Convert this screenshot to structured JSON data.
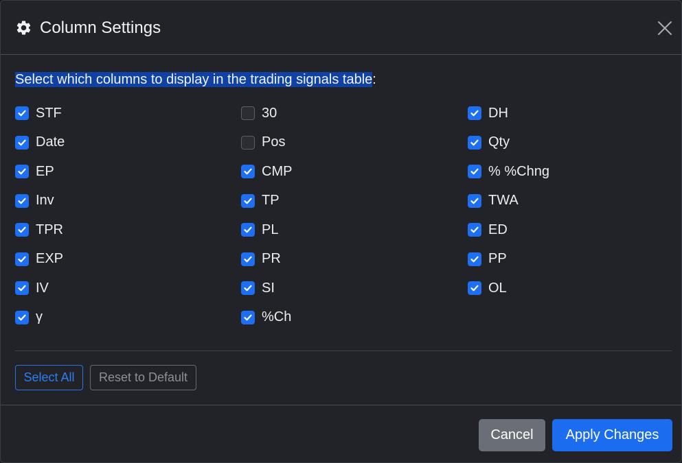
{
  "header": {
    "title": "Column Settings",
    "icon": "gear-icon",
    "close_icon": "close-icon"
  },
  "body": {
    "description_highlighted": "Select which columns to display in the trading signals table",
    "description_suffix": ":",
    "columns": [
      [
        {
          "label": "STF",
          "checked": true
        },
        {
          "label": "Date",
          "checked": true
        },
        {
          "label": "EP",
          "checked": true
        },
        {
          "label": "Inv",
          "checked": true
        },
        {
          "label": "TPR",
          "checked": true
        },
        {
          "label": "EXP",
          "checked": true
        },
        {
          "label": "IV",
          "checked": true
        },
        {
          "label": "γ",
          "checked": true
        }
      ],
      [
        {
          "label": "30",
          "checked": false
        },
        {
          "label": "Pos",
          "checked": false
        },
        {
          "label": "CMP",
          "checked": true
        },
        {
          "label": "TP",
          "checked": true
        },
        {
          "label": "PL",
          "checked": true
        },
        {
          "label": "PR",
          "checked": true
        },
        {
          "label": "SI",
          "checked": true
        },
        {
          "label": "%Ch",
          "checked": true
        }
      ],
      [
        {
          "label": "DH",
          "checked": true
        },
        {
          "label": "Qty",
          "checked": true
        },
        {
          "label": "% %Chng",
          "checked": true
        },
        {
          "label": "TWA",
          "checked": true
        },
        {
          "label": "ED",
          "checked": true
        },
        {
          "label": "PP",
          "checked": true
        },
        {
          "label": "OL",
          "checked": true
        }
      ]
    ],
    "select_all_label": "Select All",
    "reset_label": "Reset to Default"
  },
  "footer": {
    "cancel_label": "Cancel",
    "apply_label": "Apply Changes"
  },
  "colors": {
    "accent": "#1e6ff2",
    "background": "#212329",
    "highlight": "#1042a6"
  }
}
